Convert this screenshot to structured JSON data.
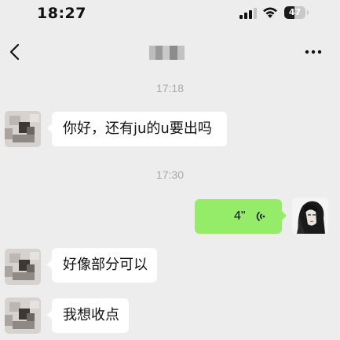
{
  "status_bar": {
    "time": "18:27",
    "battery_level": "47",
    "battery_percent": 0.47,
    "icons": [
      "signal-icon",
      "wifi-icon",
      "battery-icon"
    ]
  },
  "nav": {
    "back_icon": "chevron-left-icon",
    "more_icon": "ellipsis-icon"
  },
  "messages": {
    "timestamp_1": "17:18",
    "msg_1": "你好，还有ju的u要出吗",
    "timestamp_2": "17:30",
    "voice_duration": "4\"",
    "msg_3": "好像部分可以",
    "msg_4": "我想收点"
  },
  "colors": {
    "background": "#ededed",
    "bubble_incoming": "#ffffff",
    "bubble_outgoing": "#95ec69",
    "timestamp": "#a9a9a9"
  }
}
